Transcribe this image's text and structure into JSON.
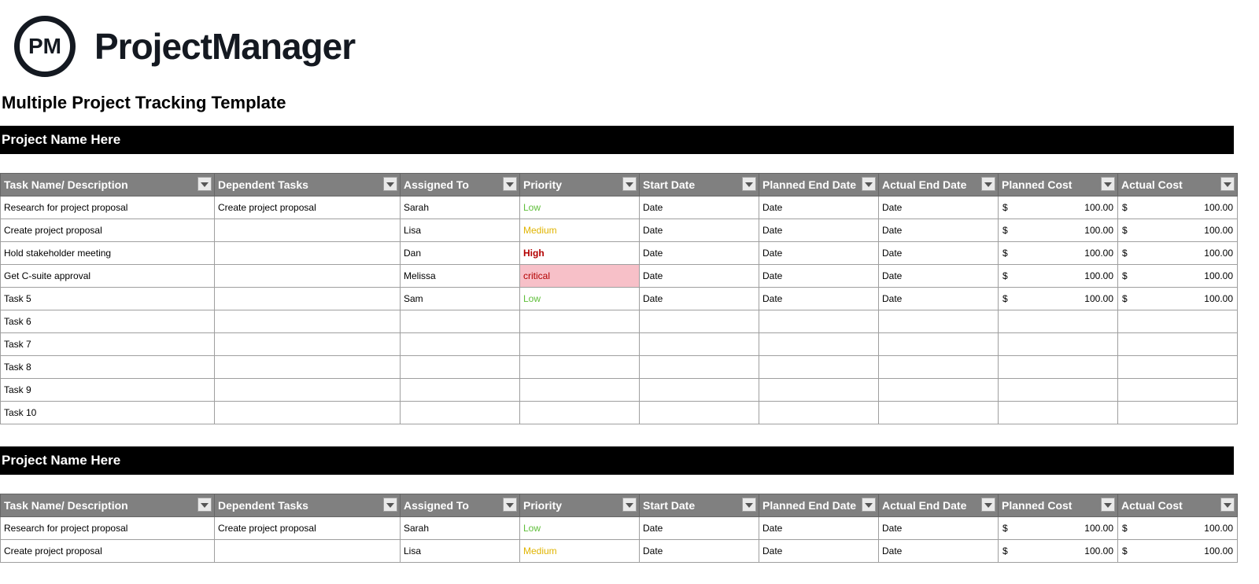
{
  "brand_abbr": "PM",
  "brand_name": "ProjectManager",
  "doc_title": "Multiple Project Tracking Template",
  "columns": [
    "Task Name/ Description",
    "Dependent Tasks",
    "Assigned To",
    "Priority",
    "Start Date",
    "Planned End Date",
    "Actual End Date",
    "Planned Cost",
    "Actual Cost"
  ],
  "currency": "$",
  "projects": [
    {
      "name": "Project Name Here",
      "rows": [
        {
          "task": "Research for project proposal",
          "dep": "Create project proposal",
          "asgn": "Sarah",
          "pri": "Low",
          "sd": "Date",
          "ped": "Date",
          "aed": "Date",
          "pc": "100.00",
          "ac": "100.00"
        },
        {
          "task": "Create project proposal",
          "dep": "",
          "asgn": "Lisa",
          "pri": "Medium",
          "sd": "Date",
          "ped": "Date",
          "aed": "Date",
          "pc": "100.00",
          "ac": "100.00"
        },
        {
          "task": "Hold stakeholder meeting",
          "dep": "",
          "asgn": "Dan",
          "pri": "High",
          "sd": "Date",
          "ped": "Date",
          "aed": "Date",
          "pc": "100.00",
          "ac": "100.00"
        },
        {
          "task": "Get C-suite approval",
          "dep": "",
          "asgn": "Melissa",
          "pri": "critical",
          "sd": "Date",
          "ped": "Date",
          "aed": "Date",
          "pc": "100.00",
          "ac": "100.00"
        },
        {
          "task": "Task 5",
          "dep": "",
          "asgn": "Sam",
          "pri": "Low",
          "sd": "Date",
          "ped": "Date",
          "aed": "Date",
          "pc": "100.00",
          "ac": "100.00"
        },
        {
          "task": "Task 6",
          "dep": "",
          "asgn": "",
          "pri": "",
          "sd": "",
          "ped": "",
          "aed": "",
          "pc": "",
          "ac": ""
        },
        {
          "task": "Task 7",
          "dep": "",
          "asgn": "",
          "pri": "",
          "sd": "",
          "ped": "",
          "aed": "",
          "pc": "",
          "ac": ""
        },
        {
          "task": "Task 8",
          "dep": "",
          "asgn": "",
          "pri": "",
          "sd": "",
          "ped": "",
          "aed": "",
          "pc": "",
          "ac": ""
        },
        {
          "task": "Task 9",
          "dep": "",
          "asgn": "",
          "pri": "",
          "sd": "",
          "ped": "",
          "aed": "",
          "pc": "",
          "ac": ""
        },
        {
          "task": "Task 10",
          "dep": "",
          "asgn": "",
          "pri": "",
          "sd": "",
          "ped": "",
          "aed": "",
          "pc": "",
          "ac": ""
        }
      ]
    },
    {
      "name": "Project Name Here",
      "rows": [
        {
          "task": "Research for project proposal",
          "dep": "Create project proposal",
          "asgn": "Sarah",
          "pri": "Low",
          "sd": "Date",
          "ped": "Date",
          "aed": "Date",
          "pc": "100.00",
          "ac": "100.00"
        },
        {
          "task": "Create project proposal",
          "dep": "",
          "asgn": "Lisa",
          "pri": "Medium",
          "sd": "Date",
          "ped": "Date",
          "aed": "Date",
          "pc": "100.00",
          "ac": "100.00"
        }
      ]
    }
  ]
}
